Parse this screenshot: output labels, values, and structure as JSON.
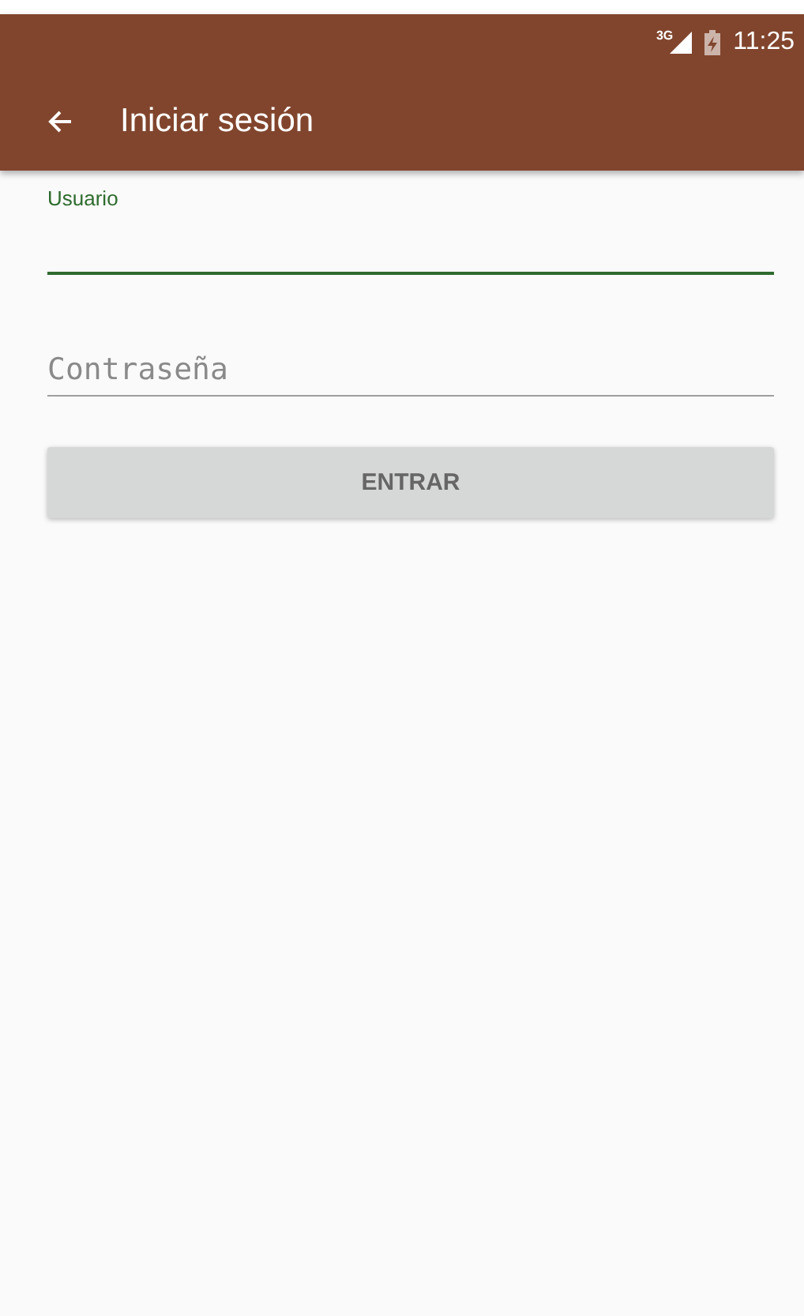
{
  "status_bar": {
    "time": "11:25",
    "network": "3G"
  },
  "toolbar": {
    "title": "Iniciar sesión"
  },
  "fields": [
    {
      "label": "Usuario",
      "focused": true
    },
    {
      "placeholder": "Contraseña",
      "focused": false
    }
  ],
  "button": {
    "label": "ENTRAR",
    "disabled": true
  }
}
